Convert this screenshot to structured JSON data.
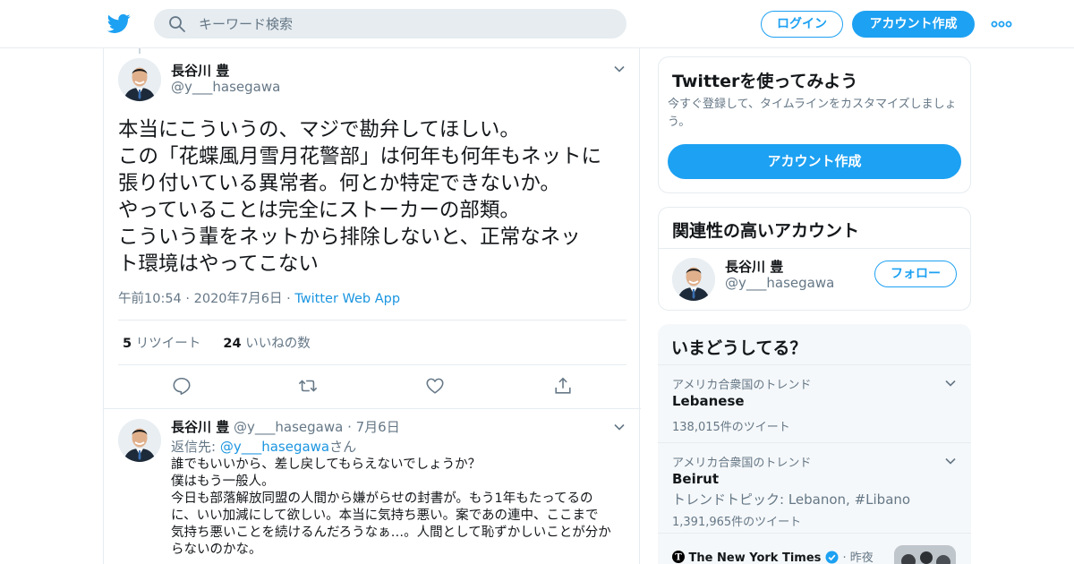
{
  "header": {
    "search_placeholder": "キーワード検索",
    "login_label": "ログイン",
    "signup_label": "アカウント作成",
    "brand_color": "#1da1f2"
  },
  "tweet": {
    "author_name": "長谷川 豊",
    "author_handle": "@y___hasegawa",
    "text_lines": [
      "本当にこういうの、マジで勘弁してほしい。",
      "この「花蝶風月雪月花警部」は何年も何年もネットに",
      "張り付いている異常者。何とか特定できないか。",
      "やっていることは完全にストーカーの部類。",
      "こういう輩をネットから排除しないと、正常なネッ",
      "ト環境はやってこない"
    ],
    "time": "午前10:54",
    "date": "2020年7月6日",
    "source": "Twitter Web App",
    "retweet_count": "5",
    "retweet_label": "リツイート",
    "like_count": "24",
    "like_label": "いいねの数"
  },
  "reply": {
    "author_name": "長谷川 豊",
    "author_handle": "@y___hasegawa",
    "date": "7月6日",
    "reply_to_prefix": "返信先: ",
    "reply_to_mention": "@y___hasegawa",
    "reply_to_suffix": "さん",
    "text_lines": [
      "誰でもいいから、差し戻してもらえないでしょうか？",
      "僕はもう一般人。",
      "今日も部落解放同盟の人間から嫌がらせの封書が。もう1年もたってるの",
      "に、いい加減にして欲しい。本当に気持ち悪い。案であの連中、ここまで",
      "気持ち悪いことを続けるんだろうなぁ…。人間として恥ずかしいことが分か",
      "らないのかな。"
    ]
  },
  "sidebar": {
    "signup_card": {
      "title": "Twitterを使ってみよう",
      "desc": "今すぐ登録して、タイムラインをカスタマイズしましょう。",
      "button": "アカウント作成"
    },
    "related_card": {
      "title": "関連性の高いアカウント",
      "account_name": "長谷川 豊",
      "account_handle": "@y___hasegawa",
      "follow_label": "フォロー"
    },
    "trends_card": {
      "title": "いまどうしてる？",
      "items": [
        {
          "context": "アメリカ合衆国のトレンド",
          "name": "Lebanese",
          "count": "138,015件のツイート"
        },
        {
          "context": "アメリカ合衆国のトレンド",
          "name": "Beirut",
          "sub": "トレンドトピック: Lebanon, #Libano",
          "count": "1,391,965件のツイート"
        }
      ],
      "news_source": "The New York Times",
      "news_time": "昨夜"
    }
  }
}
